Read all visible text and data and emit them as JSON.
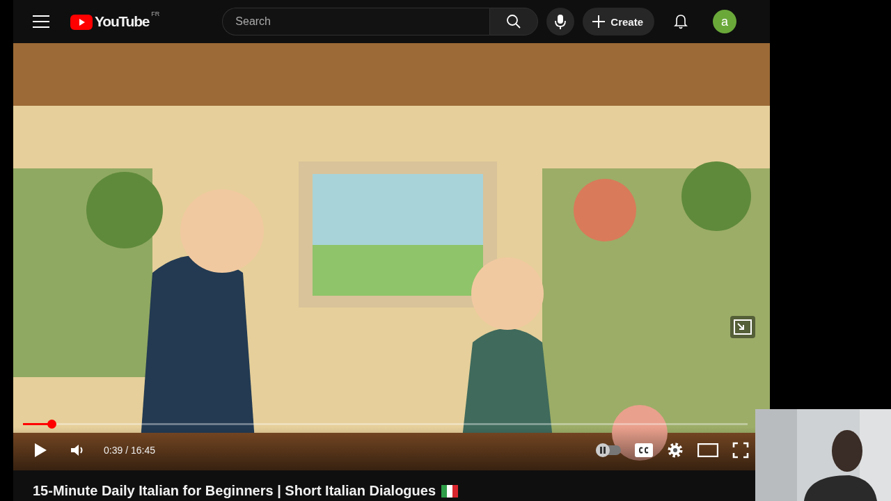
{
  "topbar": {
    "logo": "YouTube",
    "region": "FR",
    "search": {
      "placeholder": "Search"
    },
    "create": "Create",
    "avatar": "a"
  },
  "player": {
    "progress": {
      "level": 0.039
    },
    "time": "0:39 / 16:45",
    "autoplay": {
      "on": false
    }
  },
  "title": "15-Minute Daily Italian for Beginners | Short Italian Dialogues"
}
